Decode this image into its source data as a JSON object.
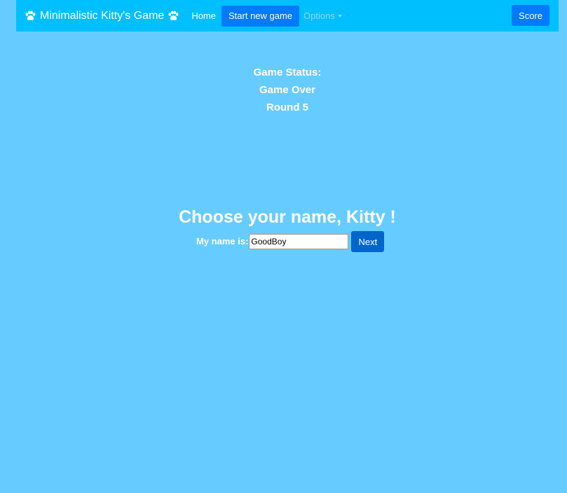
{
  "navbar": {
    "brand_text": "Minimalistic Kitty's Game",
    "brand_icon": "paw-icon",
    "home_label": "Home",
    "start_label": "Start new game",
    "options_label": "Options",
    "score_label": "Score"
  },
  "status": {
    "heading": "Game Status:",
    "state": "Game Over",
    "round": "Round 5"
  },
  "name_form": {
    "title": "Choose your name, Kitty !",
    "label": "My name is:",
    "input_value": "GoodBoy",
    "next_label": "Next"
  },
  "colors": {
    "page_background": "#66ccff",
    "navbar_background": "#00bfff",
    "button_primary": "#007bff",
    "button_next": "#0066cc"
  }
}
